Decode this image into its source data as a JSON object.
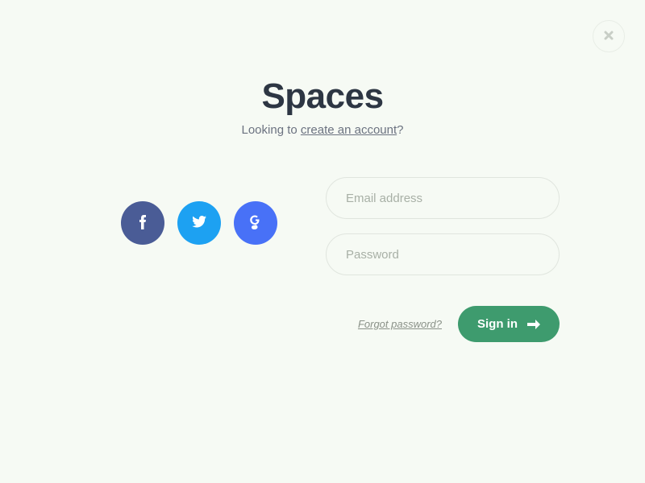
{
  "title": "Spaces",
  "subtitle_prefix": "Looking to ",
  "subtitle_link": "create an account",
  "subtitle_suffix": "?",
  "social": {
    "facebook": "facebook",
    "twitter": "twitter",
    "google": "google"
  },
  "form": {
    "email_placeholder": "Email address",
    "password_placeholder": "Password",
    "forgot_link": "Forgot password?",
    "signin_label": "Sign in"
  }
}
